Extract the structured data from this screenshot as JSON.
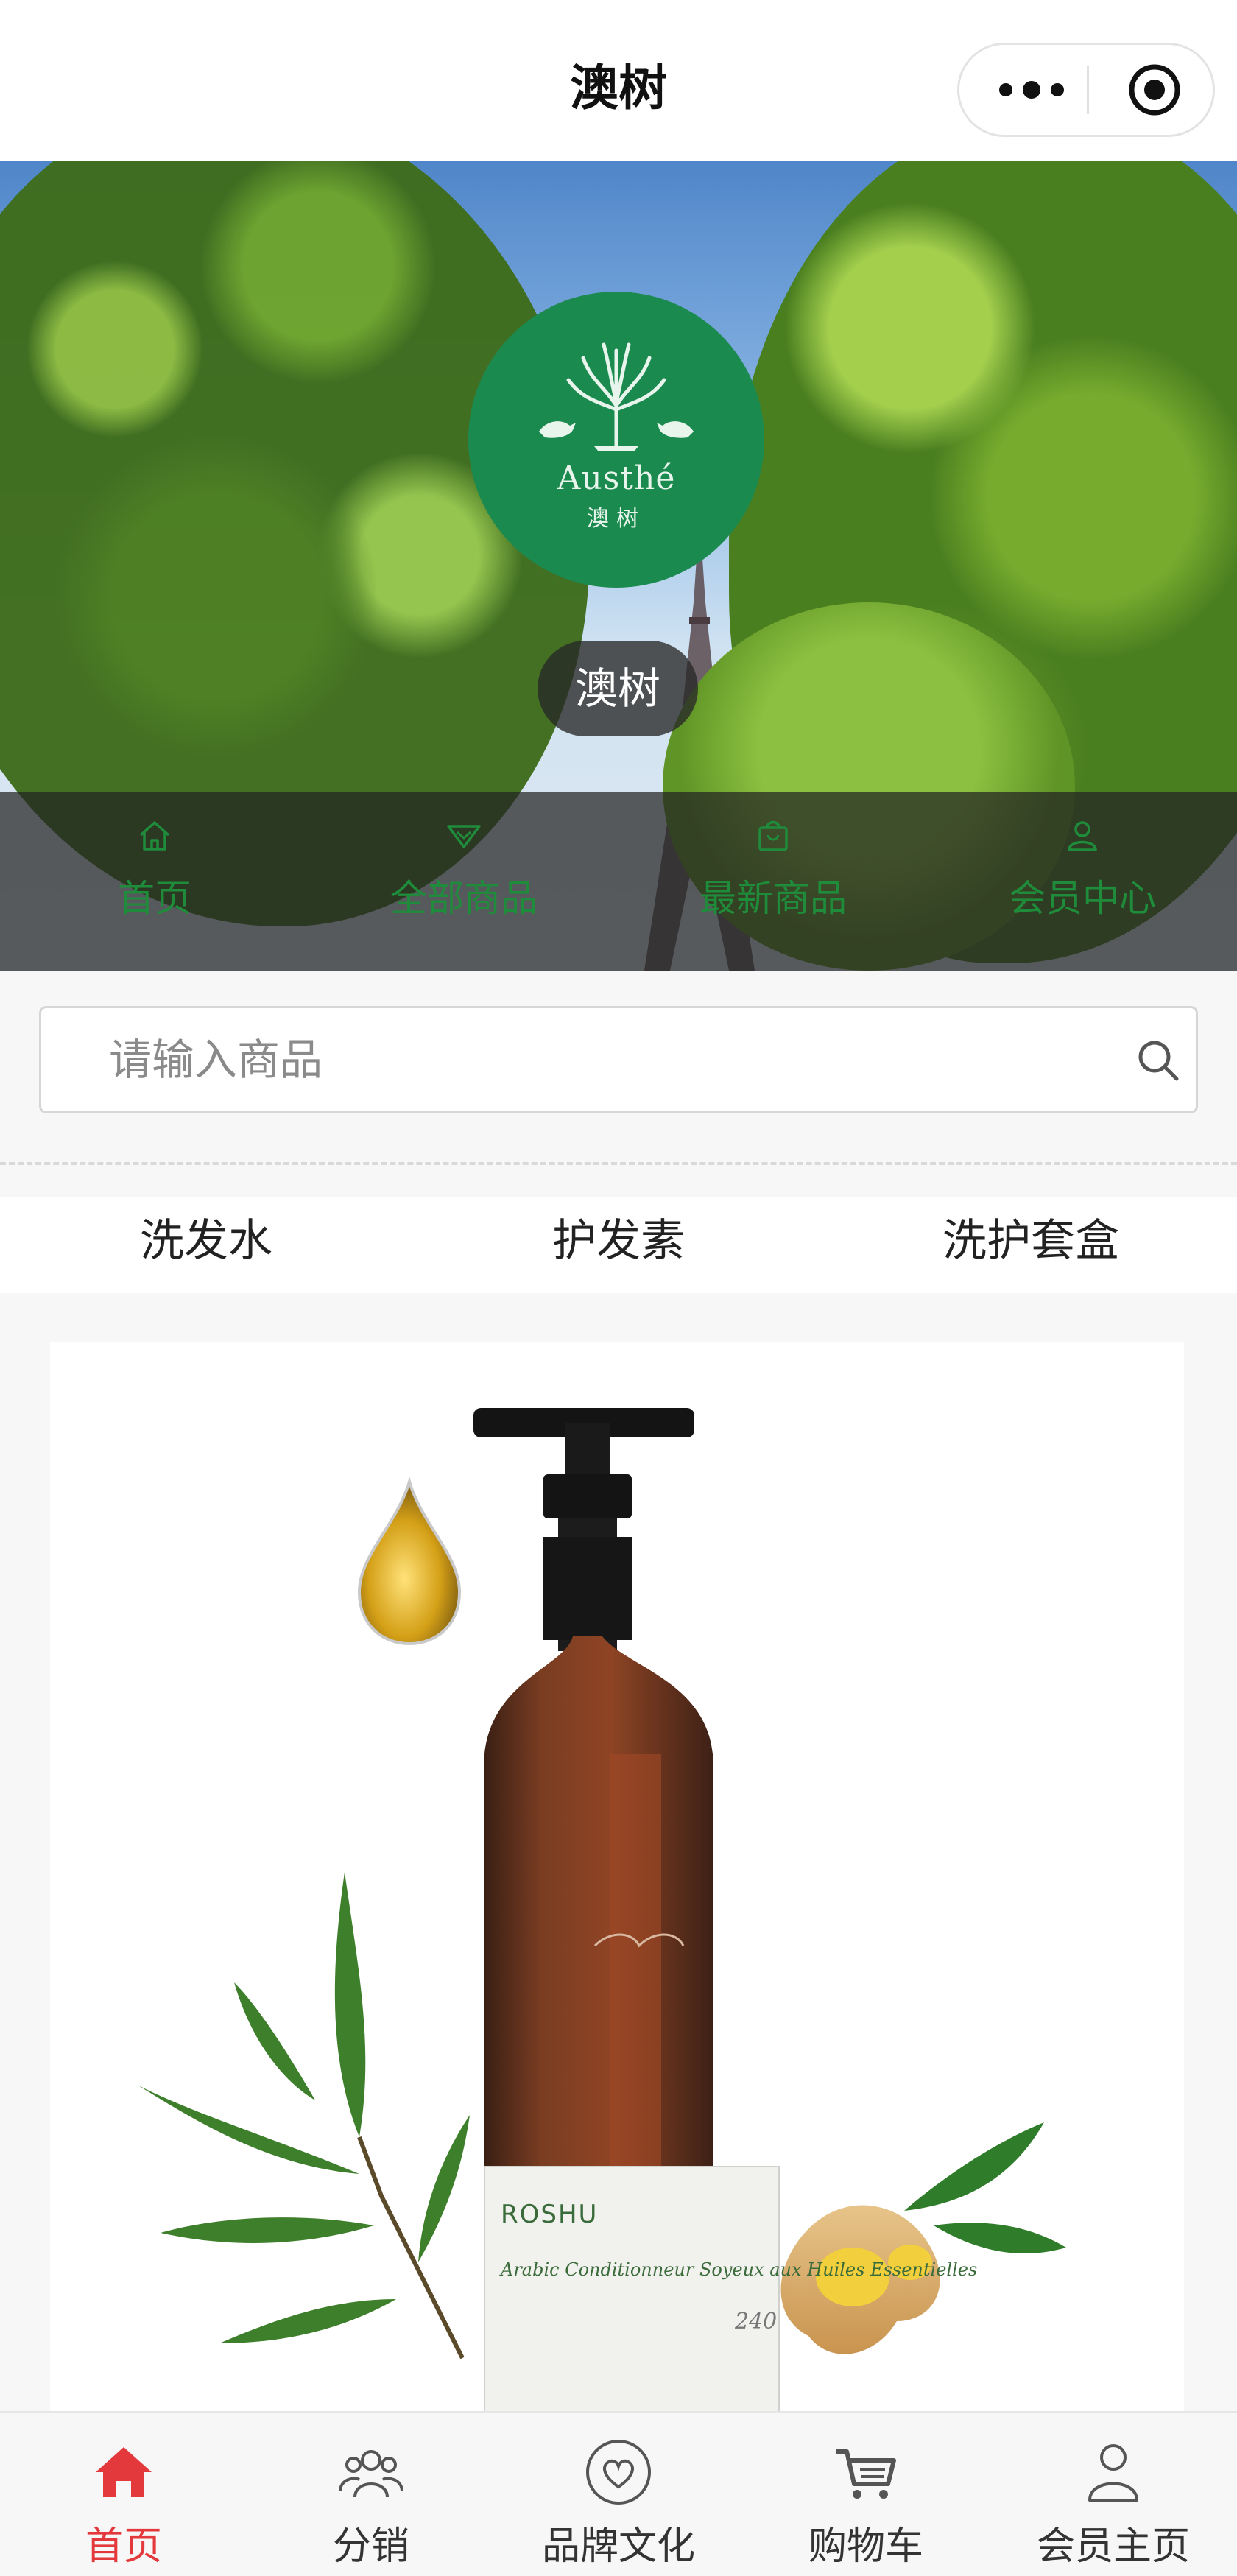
{
  "topbar": {
    "title": "澳树",
    "more_icon": "more-dots-icon",
    "close_icon": "target-circle-icon"
  },
  "hero": {
    "logo": {
      "brand_text": "Austhé",
      "brand_cn": "澳树"
    },
    "shop_name": "澳树",
    "nav": [
      {
        "label": "首页",
        "icon": "home-icon"
      },
      {
        "label": "全部商品",
        "icon": "heart-tag-icon"
      },
      {
        "label": "最新商品",
        "icon": "bag-icon"
      },
      {
        "label": "会员中心",
        "icon": "user-icon"
      }
    ]
  },
  "search": {
    "placeholder": "请输入商品",
    "icon": "search-icon"
  },
  "categories": [
    "洗发水",
    "护发素",
    "洗护套盒"
  ],
  "product": {
    "label_brand": "ROSHU",
    "label_script": "Arabic Conditionneur Soyeux aux Huiles Essentielles",
    "label_size": "240"
  },
  "tabbar": {
    "items": [
      {
        "label": "首页",
        "icon": "home-icon",
        "active": true
      },
      {
        "label": "分销",
        "icon": "group-icon",
        "active": false
      },
      {
        "label": "品牌文化",
        "icon": "heart-circle-icon",
        "active": false
      },
      {
        "label": "购物车",
        "icon": "cart-icon",
        "active": false
      },
      {
        "label": "会员主页",
        "icon": "person-icon",
        "active": false
      }
    ]
  },
  "colors": {
    "accent_red": "#e4393c",
    "brand_green": "#1b8a4f",
    "nav_green": "#1f8c3b"
  }
}
